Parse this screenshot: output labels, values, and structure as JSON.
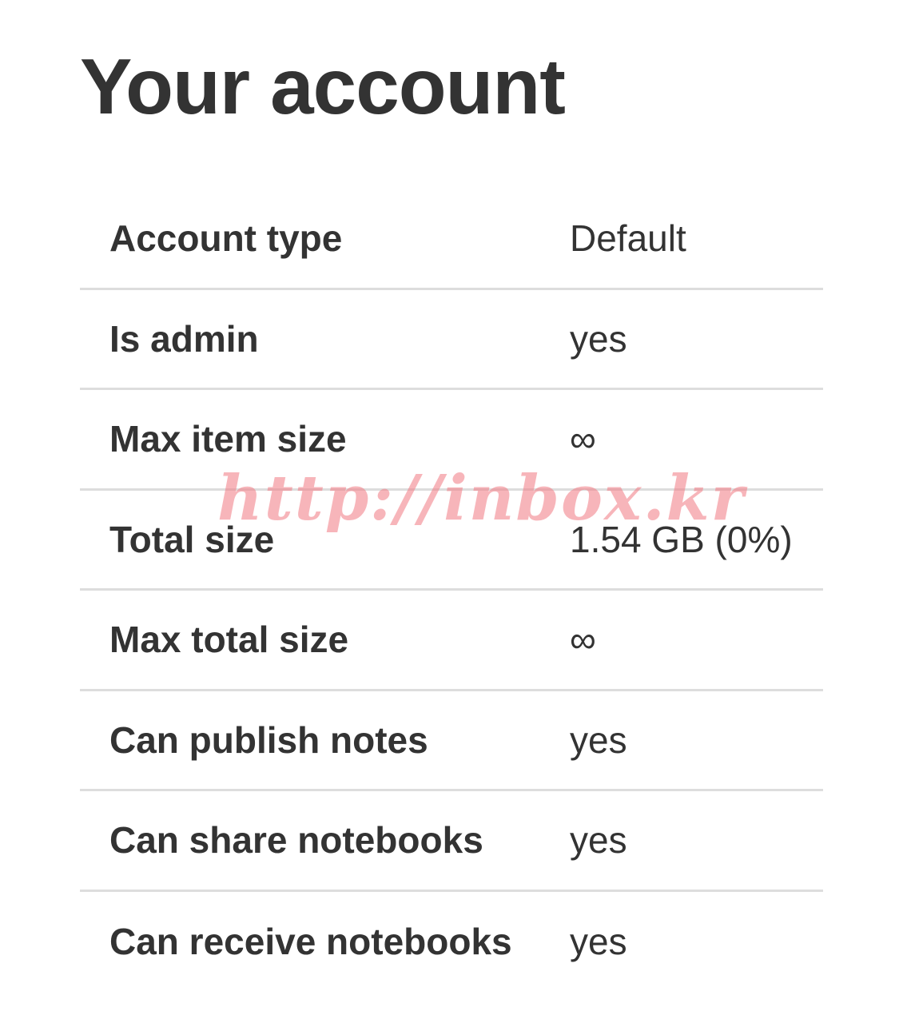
{
  "page": {
    "title": "Your account"
  },
  "account": {
    "rows": [
      {
        "label": "Account type",
        "value": "Default"
      },
      {
        "label": "Is admin",
        "value": "yes"
      },
      {
        "label": "Max item size",
        "value": "∞"
      },
      {
        "label": "Total size",
        "value": "1.54 GB (0%)"
      },
      {
        "label": "Max total size",
        "value": "∞"
      },
      {
        "label": "Can publish notes",
        "value": "yes"
      },
      {
        "label": "Can share notebooks",
        "value": "yes"
      },
      {
        "label": "Can receive notebooks",
        "value": "yes"
      }
    ]
  },
  "watermark": {
    "text": "http://inbox.kr"
  }
}
